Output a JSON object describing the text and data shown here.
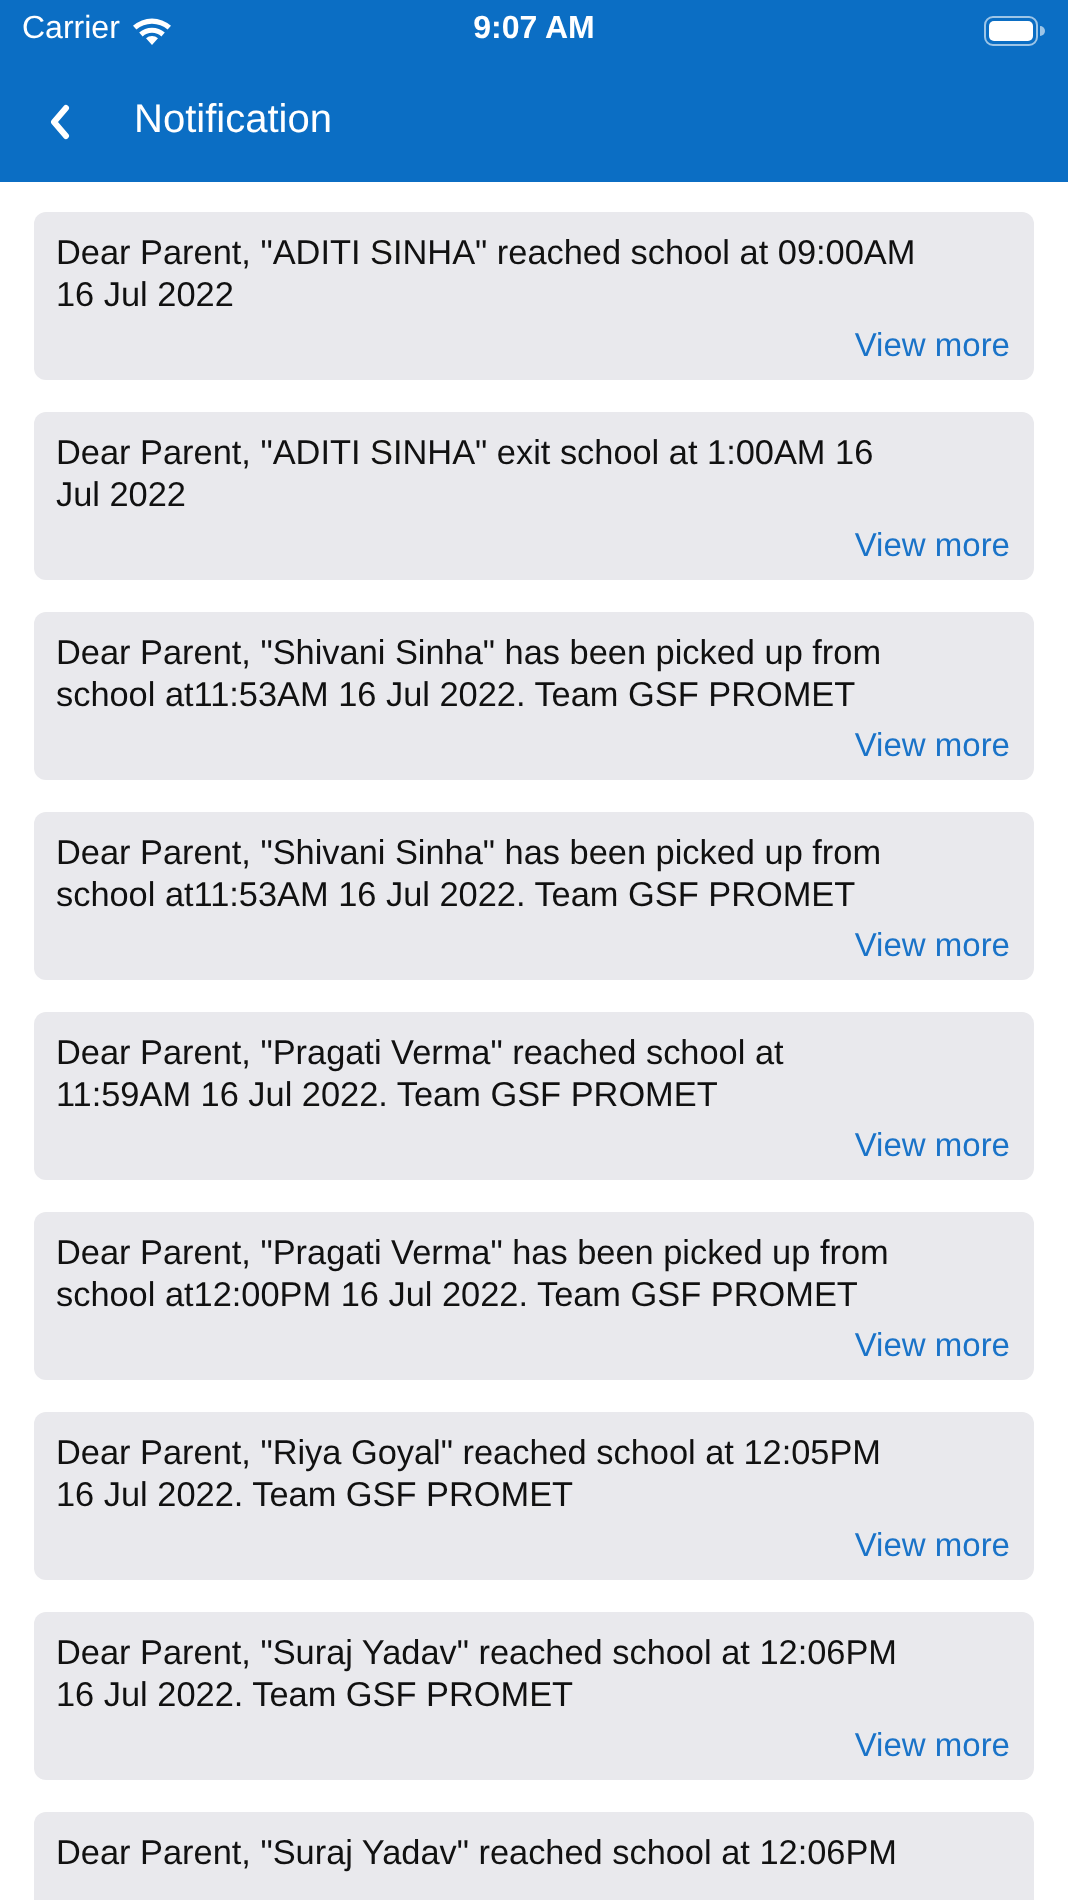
{
  "status_bar": {
    "carrier": "Carrier",
    "time": "9:07 AM"
  },
  "header": {
    "title": "Notification"
  },
  "notifications": [
    {
      "lines": [
        "Dear Parent, \"ADITI SINHA\" reached school at 09:00AM",
        "16 Jul 2022"
      ],
      "link": "View more"
    },
    {
      "lines": [
        "Dear Parent, \"ADITI SINHA\" exit school at 1:00AM 16",
        "Jul 2022"
      ],
      "link": "View more"
    },
    {
      "lines": [
        "Dear Parent, \"Shivani Sinha\" has been picked up from",
        "school at11:53AM 16 Jul 2022. Team GSF PROMET"
      ],
      "link": "View more"
    },
    {
      "lines": [
        "Dear Parent, \"Shivani Sinha\" has been picked up from",
        "school at11:53AM 16 Jul 2022. Team GSF PROMET"
      ],
      "link": "View more"
    },
    {
      "lines": [
        "Dear Parent, \"Pragati Verma\" reached school at",
        "11:59AM 16 Jul 2022. Team GSF PROMET"
      ],
      "link": "View more"
    },
    {
      "lines": [
        "Dear Parent, \"Pragati Verma\" has been picked up from",
        "school at12:00PM 16 Jul 2022. Team GSF PROMET"
      ],
      "link": "View more"
    },
    {
      "lines": [
        "Dear Parent, \"Riya Goyal\" reached school at 12:05PM",
        "16 Jul 2022. Team GSF PROMET"
      ],
      "link": "View more"
    },
    {
      "lines": [
        "Dear Parent, \"Suraj Yadav\" reached school at 12:06PM",
        "16 Jul 2022. Team GSF PROMET"
      ],
      "link": "View more"
    },
    {
      "lines": [
        "Dear Parent, \"Suraj Yadav\" reached school at 12:06PM"
      ]
    }
  ]
}
